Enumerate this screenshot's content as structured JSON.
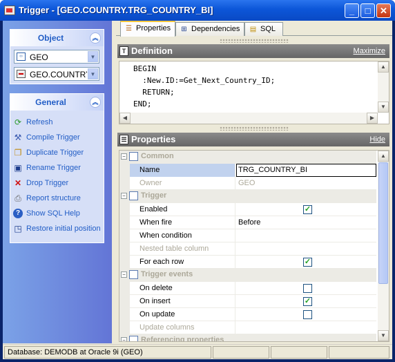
{
  "window": {
    "title": "Trigger - [GEO.COUNTRY.TRG_COUNTRY_BI]"
  },
  "object_group": {
    "title": "Object",
    "schema_value": "GEO",
    "object_value": "GEO.COUNTRY.TRG_COUNTRY_BI"
  },
  "general_group": {
    "title": "General",
    "actions": [
      {
        "label": "Refresh",
        "icon": "refresh-icon"
      },
      {
        "label": "Compile Trigger",
        "icon": "compile-icon"
      },
      {
        "label": "Duplicate Trigger",
        "icon": "duplicate-icon"
      },
      {
        "label": "Rename Trigger",
        "icon": "rename-icon"
      },
      {
        "label": "Drop Trigger",
        "icon": "drop-icon"
      },
      {
        "label": "Report structure",
        "icon": "report-icon"
      },
      {
        "label": "Show SQL Help",
        "icon": "help-icon"
      },
      {
        "label": "Restore initial position",
        "icon": "restore-icon"
      }
    ]
  },
  "tabs": [
    {
      "label": "Properties",
      "active": true
    },
    {
      "label": "Dependencies",
      "active": false
    },
    {
      "label": "SQL",
      "active": false
    }
  ],
  "definition": {
    "title": "Definition",
    "action": "Maximize",
    "code": "BEGIN\n  :New.ID:=Get_Next_Country_ID;\n  RETURN;\nEND;"
  },
  "properties": {
    "title": "Properties",
    "action": "Hide",
    "rows": [
      {
        "kind": "category",
        "label": "Common"
      },
      {
        "kind": "prop",
        "name": "Name",
        "value": "TRG_COUNTRY_BI",
        "selected": true,
        "disabled": false
      },
      {
        "kind": "prop",
        "name": "Owner",
        "value": "GEO",
        "disabled": true
      },
      {
        "kind": "category",
        "label": "Trigger"
      },
      {
        "kind": "prop",
        "name": "Enabled",
        "checkbox": true,
        "checked": true
      },
      {
        "kind": "prop",
        "name": "When fire",
        "value": "Before"
      },
      {
        "kind": "prop",
        "name": "When condition",
        "value": ""
      },
      {
        "kind": "prop",
        "name": "Nested table column",
        "value": "",
        "disabled": true
      },
      {
        "kind": "prop",
        "name": "For each row",
        "checkbox": true,
        "checked": true
      },
      {
        "kind": "category",
        "label": "Trigger events"
      },
      {
        "kind": "prop",
        "name": "On delete",
        "checkbox": true,
        "checked": false
      },
      {
        "kind": "prop",
        "name": "On insert",
        "checkbox": true,
        "checked": true
      },
      {
        "kind": "prop",
        "name": "On update",
        "checkbox": true,
        "checked": false
      },
      {
        "kind": "prop",
        "name": "Update columns",
        "value": "",
        "disabled": true
      },
      {
        "kind": "category",
        "label": "Referencing properties"
      }
    ]
  },
  "status": {
    "database": "Database: DEMODB  at Oracle 9i (GEO)"
  }
}
